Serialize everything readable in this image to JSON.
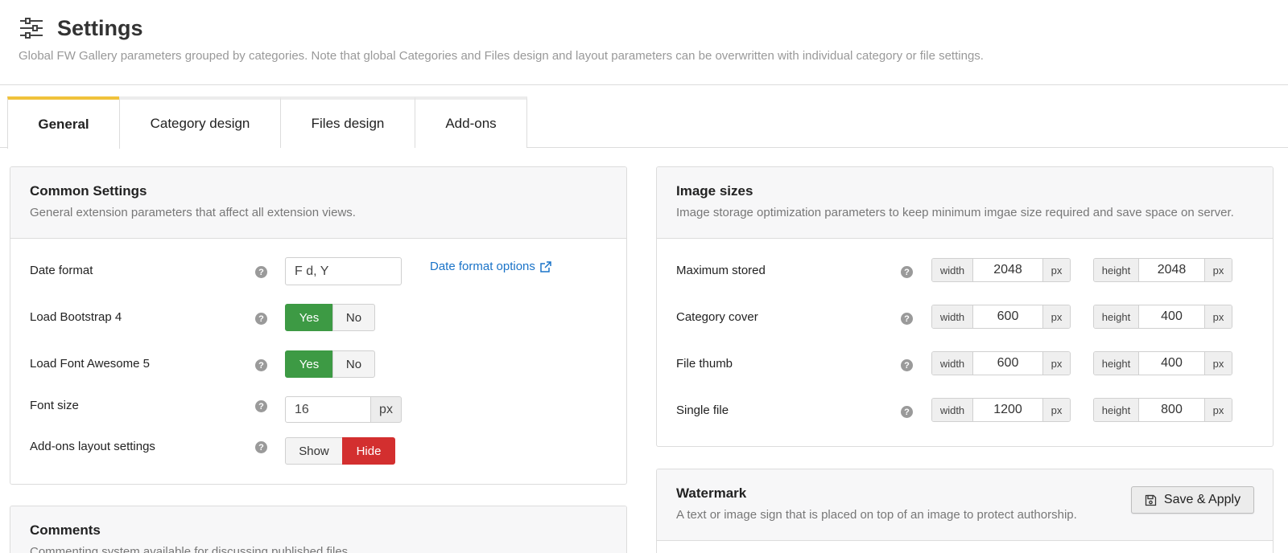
{
  "header": {
    "title": "Settings",
    "description": "Global FW Gallery parameters grouped by categories. Note that global Categories and Files design and layout parameters can be overwritten with individual category or file settings."
  },
  "tabs": [
    {
      "label": "General",
      "active": true
    },
    {
      "label": "Category design",
      "active": false
    },
    {
      "label": "Files design",
      "active": false
    },
    {
      "label": "Add-ons",
      "active": false
    }
  ],
  "common": {
    "title": "Common Settings",
    "subtitle": "General extension parameters that affect all extension views.",
    "date_format": {
      "label": "Date format",
      "value": "F d, Y",
      "link": "Date format options"
    },
    "bootstrap": {
      "label": "Load Bootstrap 4",
      "yes": "Yes",
      "no": "No",
      "selected": "Yes"
    },
    "fontawesome": {
      "label": "Load Font Awesome 5",
      "yes": "Yes",
      "no": "No",
      "selected": "Yes"
    },
    "font_size": {
      "label": "Font size",
      "value": "16",
      "unit": "px"
    },
    "addons_layout": {
      "label": "Add-ons layout settings",
      "show": "Show",
      "hide": "Hide",
      "selected": "Hide"
    }
  },
  "comments": {
    "title": "Comments",
    "subtitle": "Commenting system available for discussing published files."
  },
  "image_sizes": {
    "title": "Image sizes",
    "subtitle": "Image storage optimization parameters to keep minimum imgae size required and save space on server.",
    "width_label": "width",
    "height_label": "height",
    "unit": "px",
    "rows": [
      {
        "label": "Maximum stored",
        "width": "2048",
        "height": "2048"
      },
      {
        "label": "Category cover",
        "width": "600",
        "height": "400"
      },
      {
        "label": "File thumb",
        "width": "600",
        "height": "400"
      },
      {
        "label": "Single file",
        "width": "1200",
        "height": "800"
      }
    ]
  },
  "watermark": {
    "title": "Watermark",
    "subtitle": "A text or image sign that is placed on top of an image to protect authorship.",
    "save_label": "Save & Apply"
  },
  "help_glyph": "?",
  "colors": {
    "accent_tab": "#f0c23b",
    "yes_green": "#3d9a44",
    "hide_red": "#d32f2f",
    "link_blue": "#1a73c8"
  }
}
